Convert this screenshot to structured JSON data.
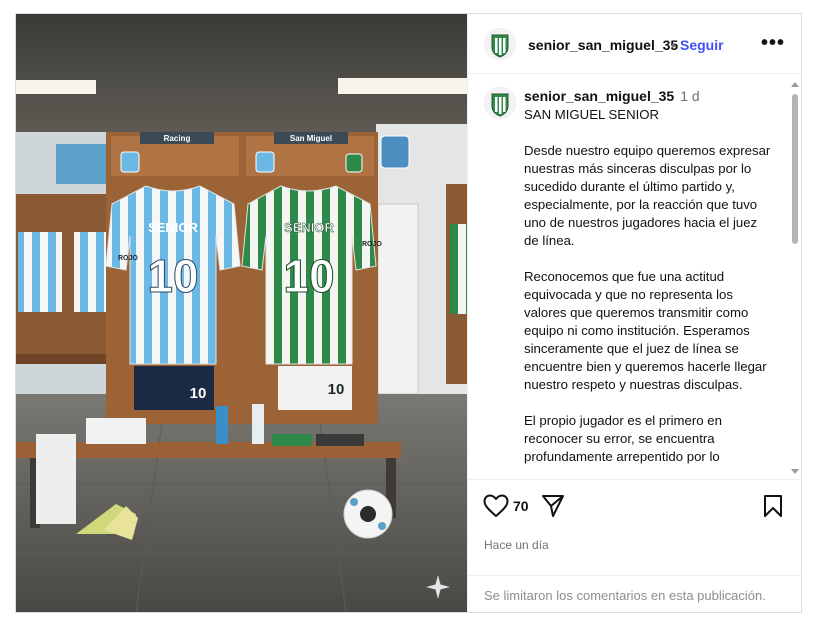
{
  "post": {
    "username": "senior_san_miguel_35",
    "follow_label": "Seguir",
    "header_dot": "•",
    "more_label": "•••",
    "time_ago": "1 d",
    "caption_title": "SAN MIGUEL SENIOR",
    "caption_body": "Desde nuestro equipo queremos expresar nuestras más sinceras disculpas por lo sucedido durante el último partido y, especialmente, por la reacción que tuvo uno de nuestros jugadores hacia el juez de línea.\n\nReconocemos que fue una actitud equivocada y que no representa los valores que queremos transmitir como equipo ni como institución. Esperamos sinceramente que el juez de línea se encuentre bien y queremos hacerle llegar nuestro respeto y nuestras disculpas.\n\nEl propio jugador es el primero en reconocer su error, se encuentra profundamente arrepentido por lo",
    "likes": "70",
    "posted": "Hace un día",
    "comments_disabled": "Se limitaron los comentarios en esta publicación."
  },
  "image": {
    "locker_left_label": "Racing",
    "locker_right_label": "San Miguel",
    "jersey_text": "SENIOR",
    "jersey_number": "10",
    "shorts_number": "10",
    "sponsor": "ROJO",
    "left_jersey_color": "#6cb8e4",
    "right_jersey_color": "#2f8a4a"
  },
  "icons": {
    "like": "heart-icon",
    "share": "paper-plane-icon",
    "save": "bookmark-icon",
    "more": "more-options-icon",
    "ai": "sparkle-icon"
  },
  "colors": {
    "follow": "#4150f7",
    "muted": "#737373",
    "border": "#dcdcdc"
  }
}
